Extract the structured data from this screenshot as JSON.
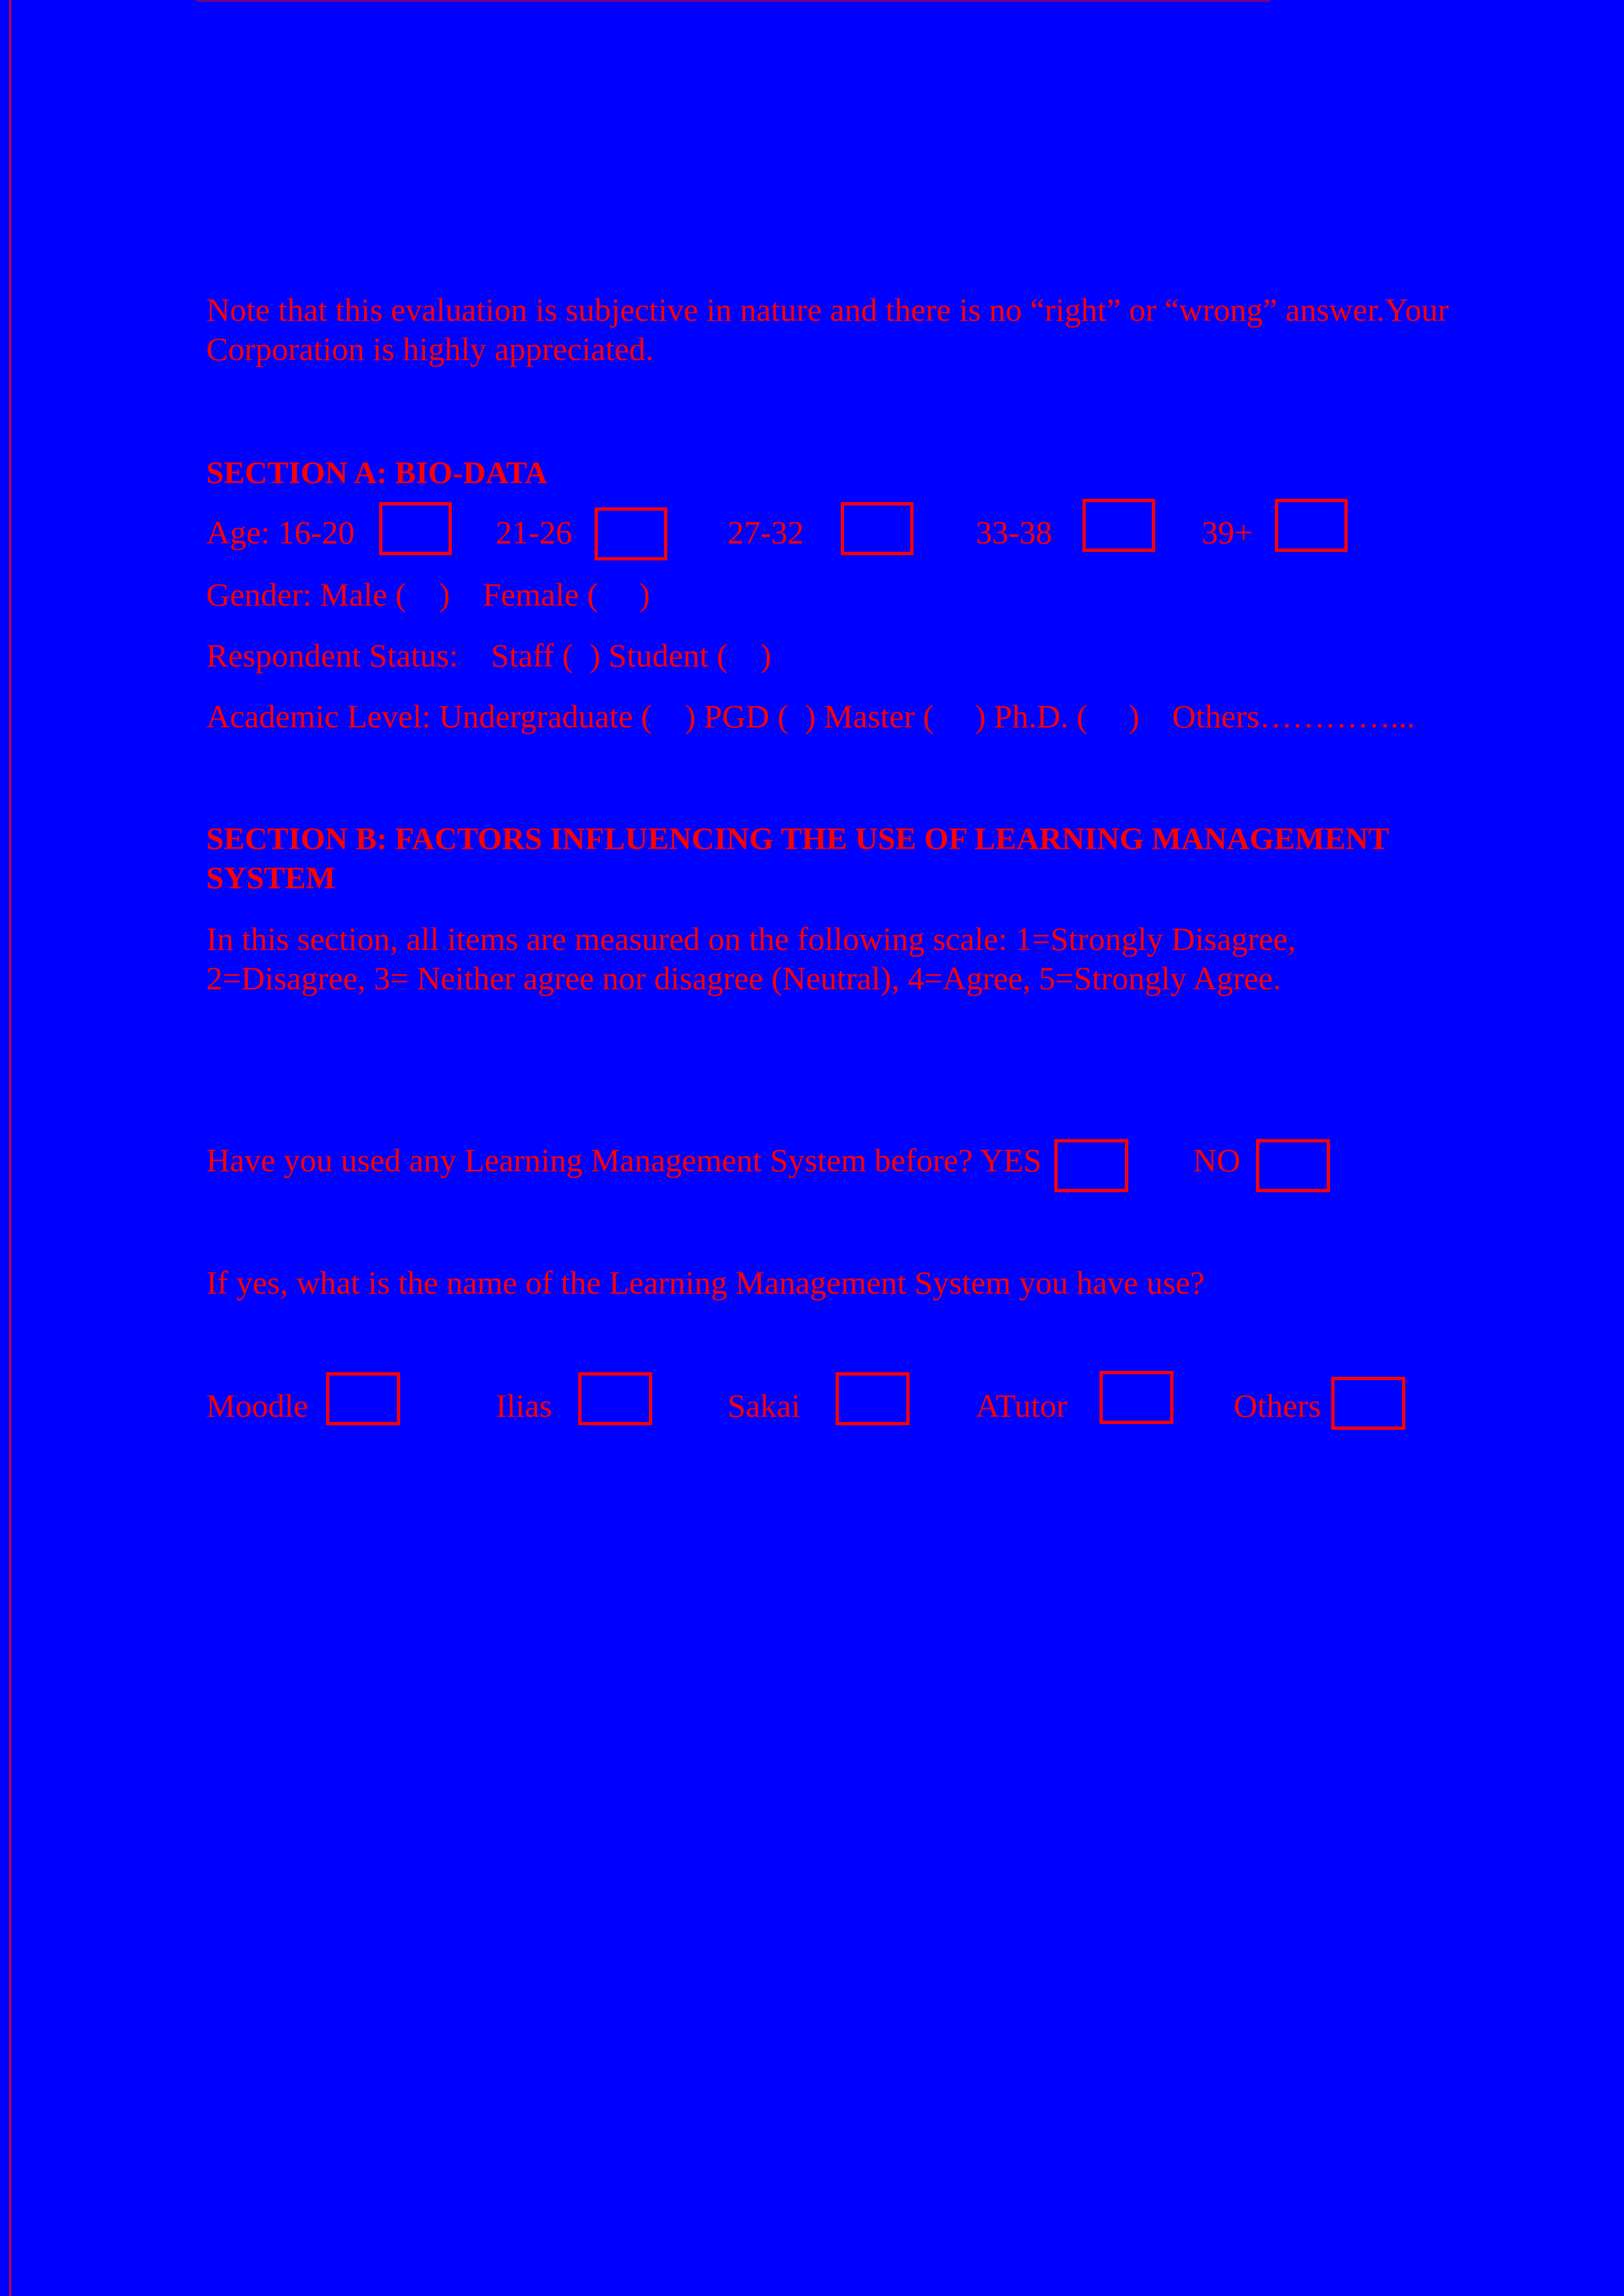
{
  "note": {
    "text": "Note that this evaluation is subjective in nature and there is no “right” or “wrong” answer.Your Corporation is highly appreciated."
  },
  "section_a": {
    "title": "SECTION A: BIO-DATA",
    "age": {
      "label": "Age: 16-20",
      "options": [
        "21-26",
        "27-32",
        "33-38",
        "39+"
      ]
    },
    "gender": "Gender: Male (    )    Female (     )",
    "respondent_status": "Respondent Status:    Staff (  ) Student (    )",
    "academic_level": "Academic Level: Undergraduate (    ) PGD (  ) Master (     ) Ph.D. (     )    Others…………..."
  },
  "section_b": {
    "title": "SECTION B: FACTORS INFLUENCING THE USE OF LEARNING MANAGEMENT SYSTEM",
    "scale_text": "In this section, all items are measured on the following scale: 1=Strongly Disagree, 2=Disagree, 3= Neither agree nor disagree (Neutral), 4=Agree, 5=Strongly Agree.",
    "used_question": "Have you used any Learning Management System before? YES",
    "no_label": "NO",
    "name_question": "If yes, what is the name of the Learning Management System you have use?",
    "lms_options": [
      "Moodle",
      "Ilias",
      "Sakai",
      "ATutor",
      "Others"
    ]
  },
  "colors": {
    "background": "#0000ff",
    "text": "#ff0000"
  }
}
